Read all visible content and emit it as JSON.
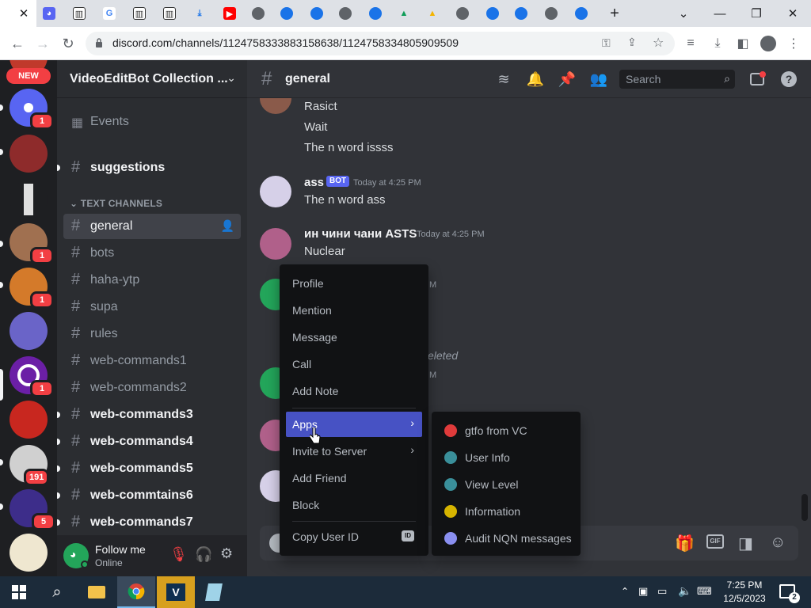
{
  "browser": {
    "url": "discord.com/channels/1124758333883158638/1124758334805909509",
    "tab_count": "24"
  },
  "rail": {
    "new_label": "NEW",
    "badges": [
      "1",
      "1",
      "1",
      "1",
      "191",
      "5"
    ]
  },
  "server": {
    "name": "VideoEditBot Collection ...",
    "events_label": "Events",
    "top_channel": "suggestions",
    "category": "TEXT CHANNELS",
    "channels": [
      "general",
      "bots",
      "haha-ytp",
      "supa",
      "rules",
      "web-commands1",
      "web-commands2",
      "web-commands3",
      "web-commands4",
      "web-commands5",
      "web-commtains6",
      "web-commands7"
    ]
  },
  "user": {
    "name": "Follow me",
    "status": "Online"
  },
  "chat": {
    "channel": "general",
    "search_placeholder": "Search",
    "messages": {
      "lines_top": [
        "Rasict",
        "Wait",
        "The n word issss"
      ],
      "m1_author": "ass",
      "m1_badge": "BOT",
      "m1_time": "Today at 4:25 PM",
      "m1_text": "The n word ass",
      "m2_author": "ин чини чани ASTS",
      "m2_time": "Today at 4:25 PM",
      "m2_text": "Nuclear",
      "partial_time_1": "M",
      "partial_deleted": "eleted",
      "partial_time_2": "M"
    }
  },
  "context_menu": {
    "items": [
      "Profile",
      "Mention",
      "Message",
      "Call",
      "Add Note",
      "Apps",
      "Invite to Server",
      "Add Friend",
      "Block",
      "Copy User ID"
    ],
    "id_icon": "ID"
  },
  "apps_submenu": {
    "items": [
      "gtfo from VC",
      "User Info",
      "View Level",
      "Information",
      "Audit NQN messages"
    ],
    "icon_colors": [
      "#e03b3b",
      "#3a8f9a",
      "#3a8f9a",
      "#d6b400",
      "#8a8ff0"
    ]
  },
  "taskbar": {
    "time": "7:25 PM",
    "date": "12/5/2023",
    "notifications": "2"
  },
  "colors": {
    "accent": "#5865f2",
    "highlight": "#4752c4",
    "badge": "#f23f43",
    "online": "#23a55a"
  }
}
